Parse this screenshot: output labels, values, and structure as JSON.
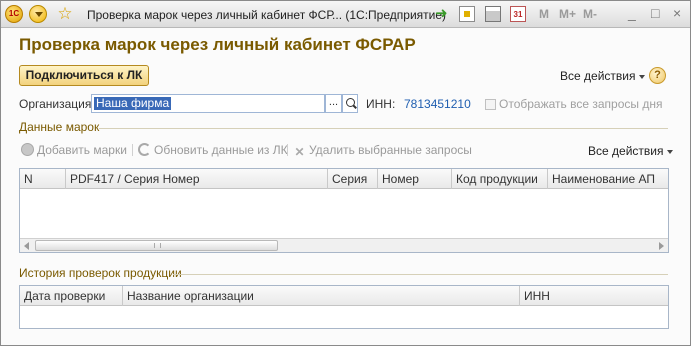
{
  "window": {
    "title": "Проверка марок через личный кабинет ФСР... (1С:Предприятие)",
    "logo_text": "1С",
    "toolbar_m": [
      "M",
      "M+",
      "M-"
    ],
    "controls": [
      "_",
      "□",
      "×"
    ]
  },
  "page": {
    "heading": "Проверка марок через личный кабинет ФСРАР",
    "connect_button": "Подключиться к ЛК",
    "all_actions": "Все действия",
    "help": "?"
  },
  "organization": {
    "label": "Организация:",
    "value": "Наша фирма",
    "dots": "...",
    "inn_label": "ИНН:",
    "inn_value": "7813451210",
    "show_all_label": "Отображать все запросы дня",
    "show_all_checked": false
  },
  "marks_section": {
    "title": "Данные марок",
    "toolbar": {
      "add": "Добавить марки",
      "refresh": "Обновить данные из ЛК",
      "delete": "Удалить выбранные запросы",
      "all_actions": "Все действия"
    },
    "columns": [
      "N",
      "PDF417 / Серия Номер",
      "Серия",
      "Номер",
      "Код продукции",
      "Наименование АП"
    ],
    "rows": []
  },
  "history_section": {
    "title": "История проверок продукции",
    "columns": [
      "Дата проверки",
      "Название организации",
      "ИНН"
    ],
    "rows": []
  },
  "colors": {
    "heading": "#7a5a00",
    "link": "#1f5eb0",
    "selection": "#3969b7",
    "button_gradient_top": "#fff4c7",
    "button_gradient_bottom": "#f2d27d"
  }
}
